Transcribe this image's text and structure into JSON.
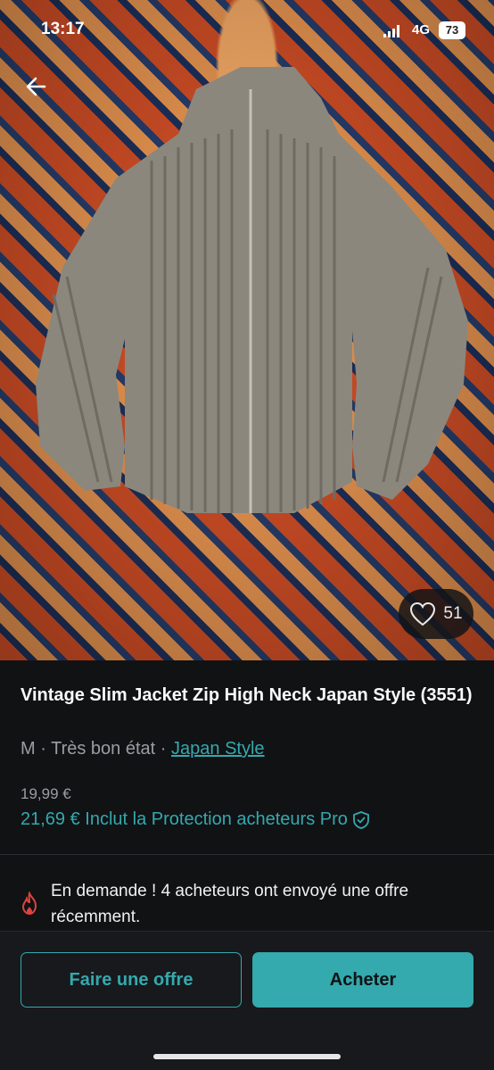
{
  "status_bar": {
    "time": "13:17",
    "network": "4G",
    "battery": "73"
  },
  "listing": {
    "title": "Vintage Slim Jacket Zip High Neck Japan Style (3551)",
    "size": "M",
    "separator": "·",
    "condition": "Très bon état",
    "brand": "Japan Style",
    "price": "19,99 €",
    "price_total": "21,69 € Inclut la Protection acheteurs Pro",
    "likes": "51"
  },
  "demand": {
    "message": "En demande ! 4 acheteurs ont envoyé une offre récemment."
  },
  "actions": {
    "offer_label": "Faire une offre",
    "buy_label": "Acheter"
  },
  "colors": {
    "accent": "#34a9ae",
    "background": "#111214",
    "demand_icon": "#e0433c"
  },
  "icons": {
    "back": "back-arrow-icon",
    "like": "heart-icon",
    "protection": "shield-check-icon",
    "demand": "flame-icon"
  }
}
